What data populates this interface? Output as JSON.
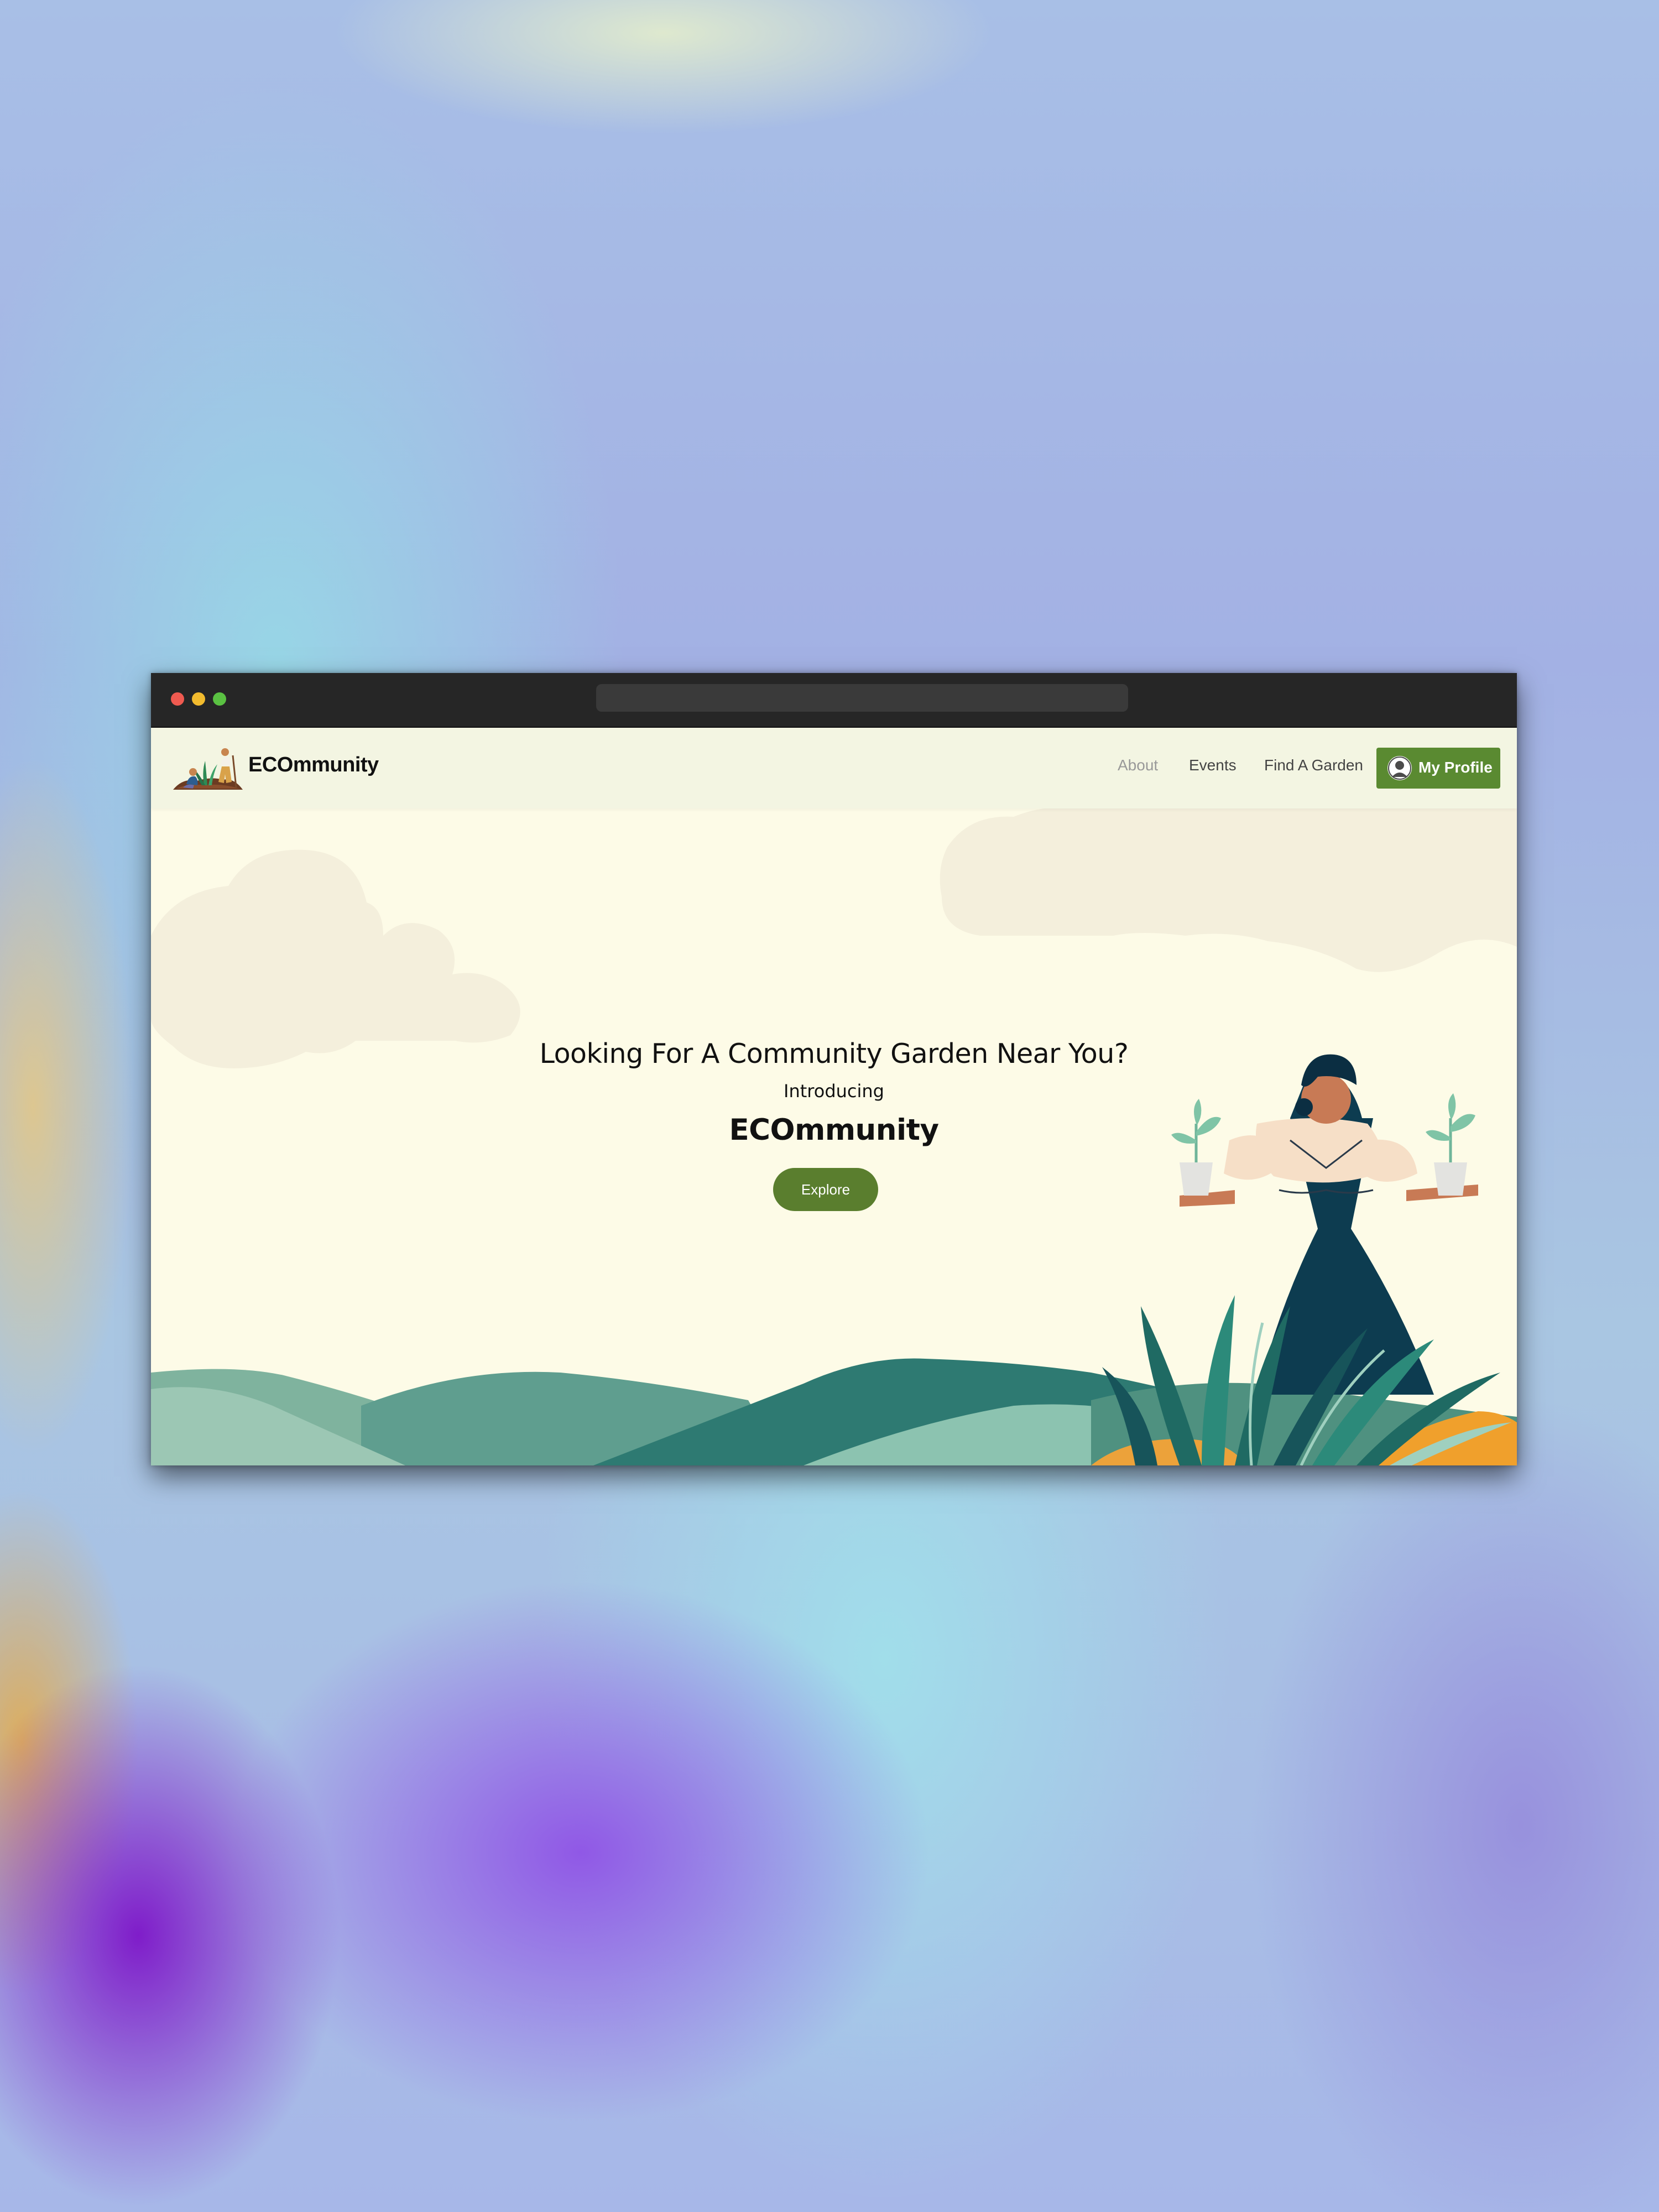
{
  "brand": "ECOmmunity",
  "nav": {
    "about": "About",
    "events": "Events",
    "find_garden": "Find A Garden",
    "profile": "My Profile"
  },
  "hero": {
    "headline": "Looking For A Community Garden Near You?",
    "intro": "Introducing",
    "brand": "ECOmmunity",
    "explore": "Explore"
  },
  "colors": {
    "accent_green": "#5a8a31",
    "hero_background": "#fdfbe7",
    "navbar_background": "#f3f5e2",
    "browser_chrome": "#262626"
  },
  "icons": [
    "gardeners-logo",
    "user-avatar-icon",
    "window-close-dot",
    "window-minimize-dot",
    "window-maximize-dot"
  ]
}
